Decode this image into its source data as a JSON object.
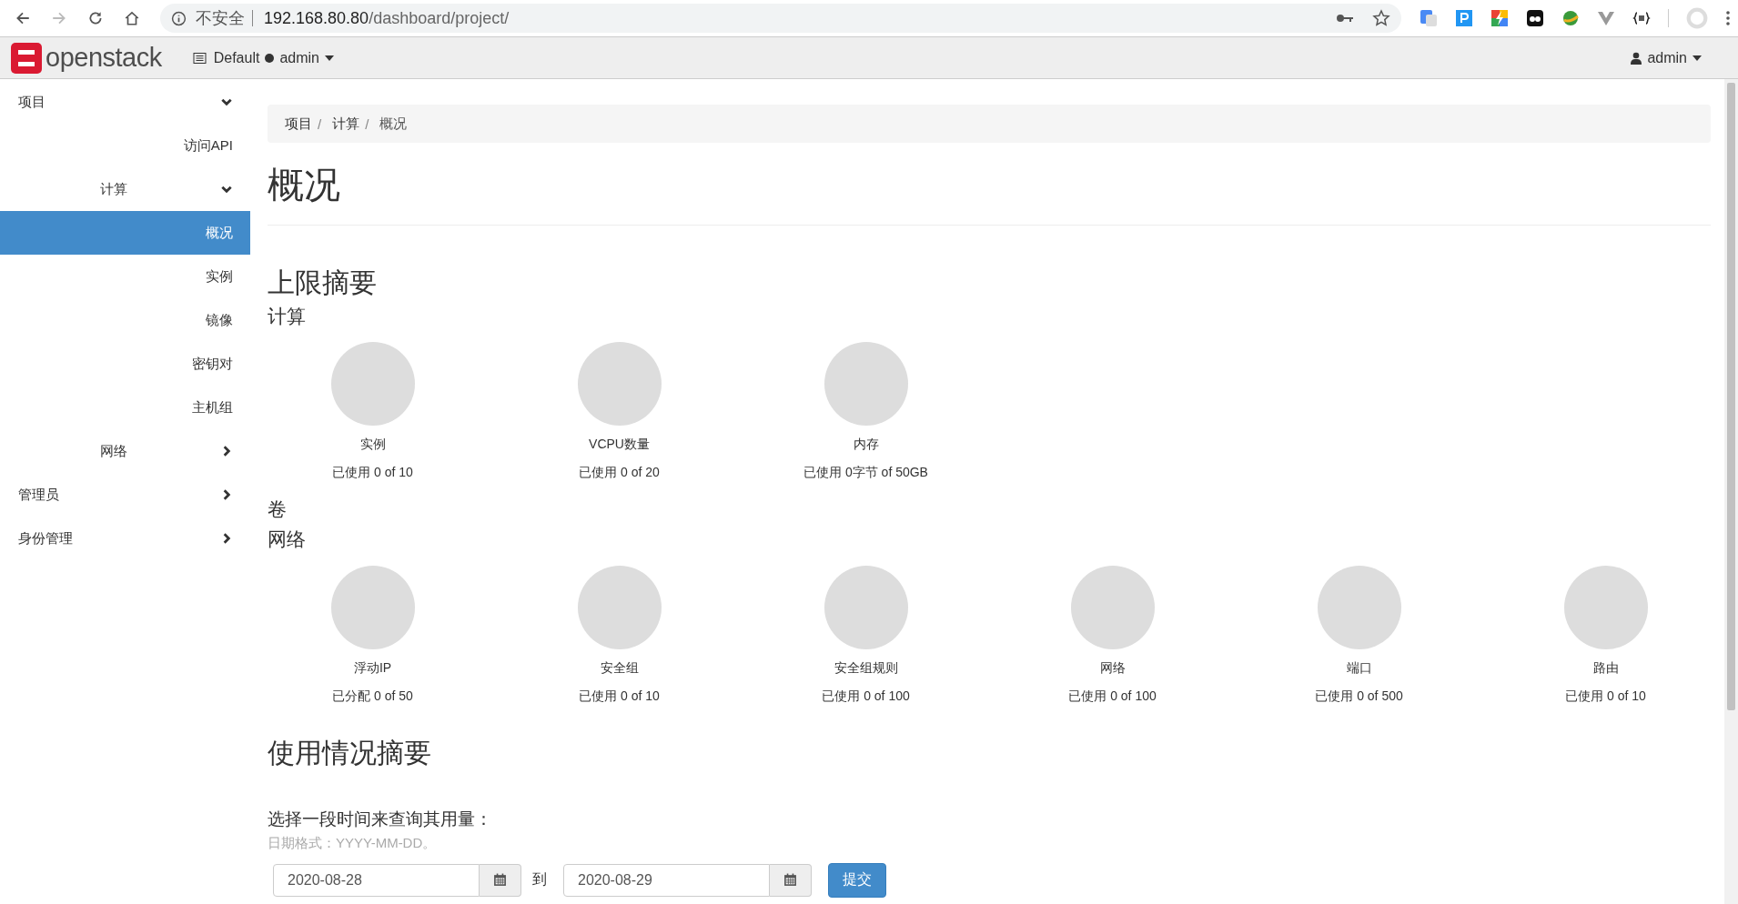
{
  "browser": {
    "security_label": "不安全",
    "url_host": "192.168.80.80",
    "url_path": "/dashboard/project/"
  },
  "header": {
    "logo_text": "openstack",
    "domain": "Default",
    "project": "admin",
    "user": "admin"
  },
  "sidebar": {
    "items": [
      {
        "label": "项目",
        "expanded": true,
        "selected": false,
        "children": [
          {
            "label": "访问API",
            "selected": false
          },
          {
            "label": "计算",
            "expanded": true,
            "selected": false,
            "children": [
              {
                "label": "概况",
                "selected": true
              },
              {
                "label": "实例",
                "selected": false
              },
              {
                "label": "镜像",
                "selected": false
              },
              {
                "label": "密钥对",
                "selected": false
              },
              {
                "label": "主机组",
                "selected": false
              }
            ]
          },
          {
            "label": "网络",
            "expanded": false,
            "selected": false
          }
        ]
      },
      {
        "label": "管理员",
        "expanded": false,
        "selected": false
      },
      {
        "label": "身份管理",
        "expanded": false,
        "selected": false
      }
    ]
  },
  "breadcrumb": {
    "separator": "/",
    "items": [
      "项目",
      "计算",
      "概况"
    ]
  },
  "page_title": "概况",
  "quota_summary": {
    "title": "上限摘要",
    "groups": [
      {
        "title": "计算",
        "quotas": [
          {
            "label": "实例",
            "usage": "已使用 0 of 10"
          },
          {
            "label": "VCPU数量",
            "usage": "已使用 0 of 20"
          },
          {
            "label": "内存",
            "usage": "已使用 0字节 of 50GB"
          }
        ]
      },
      {
        "title": "卷"
      },
      {
        "title": "网络",
        "quotas": [
          {
            "label": "浮动IP",
            "usage": "已分配 0 of 50"
          },
          {
            "label": "安全组",
            "usage": "已使用 0 of 10"
          },
          {
            "label": "安全组规则",
            "usage": "已使用 0 of 100"
          },
          {
            "label": "网络",
            "usage": "已使用 0 of 100"
          },
          {
            "label": "端口",
            "usage": "已使用 0 of 500"
          },
          {
            "label": "路由",
            "usage": "已使用 0 of 10"
          }
        ]
      }
    ]
  },
  "usage_summary": {
    "title": "使用情况摘要",
    "prompt": "选择一段时间来查询其用量：",
    "help": "日期格式：YYYY-MM-DD。",
    "start": "2020-08-28",
    "to_label": "到",
    "end": "2020-08-29",
    "submit": "提交"
  }
}
